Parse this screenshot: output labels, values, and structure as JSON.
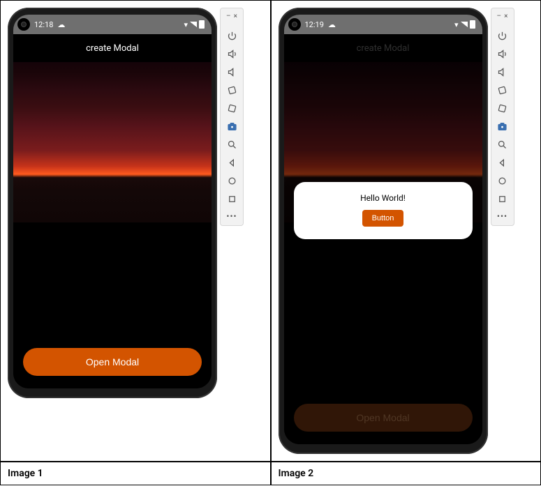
{
  "emulator_toolbar": {
    "icons": [
      "power",
      "volume-up",
      "volume-down",
      "rotate-left",
      "rotate-right",
      "camera",
      "zoom",
      "back",
      "home",
      "overview",
      "more"
    ]
  },
  "image1": {
    "caption": "Image 1",
    "status_time": "12:18",
    "status_weather_icon": "cloud",
    "header_title": "create Modal",
    "open_button_label": "Open Modal"
  },
  "image2": {
    "caption": "Image 2",
    "status_time": "12:19",
    "status_weather_icon": "cloud",
    "header_title": "create Modal",
    "open_button_label": "Open Modal",
    "modal": {
      "title": "Hello World!",
      "button_label": "Button"
    }
  }
}
